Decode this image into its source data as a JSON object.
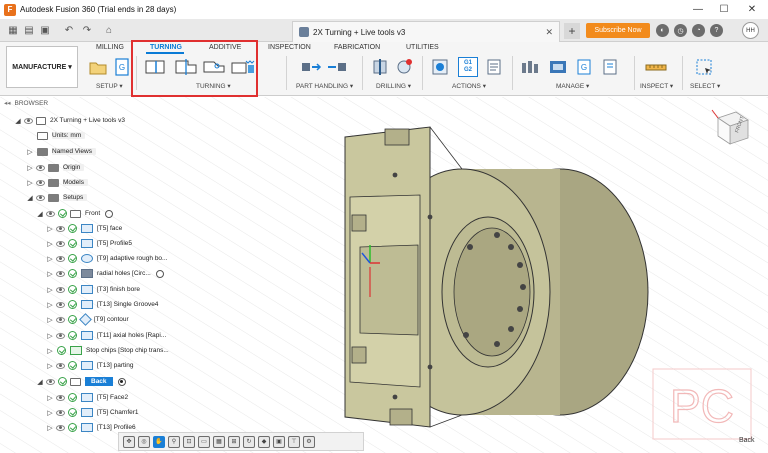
{
  "window": {
    "title": "Autodesk Fusion 360 (Trial ends in 28 days)",
    "minimize": "—",
    "maximize": "☐",
    "close": "✕"
  },
  "tabbar": {
    "document_tab": "2X Turning + Live tools v3",
    "close_glyph": "✕",
    "new_tab_glyph": "+",
    "subscribe_label": "Subscribe Now",
    "user_initials": "HH"
  },
  "ribbon": {
    "workspace": "MANUFACTURE ▾",
    "tabs": [
      "MILLING",
      "TURNING",
      "ADDITIVE",
      "INSPECTION",
      "FABRICATION",
      "UTILITIES"
    ],
    "active_tab": "TURNING",
    "groups": [
      "SETUP ▾",
      "TURNING ▾",
      "PART HANDLING ▾",
      "DRILLING ▾",
      "ACTIONS ▾",
      "MANAGE ▾",
      "INSPECT ▾",
      "SELECT ▾"
    ],
    "actions_labels": [
      "G1",
      "G2"
    ]
  },
  "browser": {
    "title": "BROWSER",
    "collapse_glyph": "◂◂",
    "rows": [
      {
        "label": "2X Turning + Live tools v3"
      },
      {
        "label": "Units: mm"
      },
      {
        "label": "Named Views"
      },
      {
        "label": "Origin"
      },
      {
        "label": "Models"
      },
      {
        "label": "Setups"
      },
      {
        "label": "Front"
      },
      {
        "label": "[T5] face"
      },
      {
        "label": "[T5] Profile5"
      },
      {
        "label": "[T9] adaptive rough bo..."
      },
      {
        "label": "radial holes [Circ..."
      },
      {
        "label": "[T3] finish bore"
      },
      {
        "label": "[T13] Single Groove4"
      },
      {
        "label": "[T9] contour"
      },
      {
        "label": "[T11] axial holes [Rapi..."
      },
      {
        "label": "Stop chips [Stop chip trans..."
      },
      {
        "label": "[T13] parting"
      },
      {
        "label": "Back"
      },
      {
        "label": "[T5] Face2"
      },
      {
        "label": "[T5] Chamfer1"
      },
      {
        "label": "[T13] Profile6"
      }
    ]
  },
  "viewport": {
    "viewcube_label": "FRONT",
    "back_label": "Back",
    "watermark": "PC"
  },
  "bottom_toolbar": {
    "icons": [
      "move-icon",
      "orbit-icon",
      "hand-icon",
      "zoom-icon",
      "zoom-fit-icon",
      "display-icon",
      "grid-icon",
      "viewports-icon",
      "refresh-icon",
      "color-icon",
      "effects-icon",
      "filter-icon",
      "settings-icon"
    ]
  },
  "colors": {
    "accent": "#0a7bd6",
    "highlight": "#e03030",
    "subscribe": "#f28b1c",
    "part": "#c5c39b"
  }
}
